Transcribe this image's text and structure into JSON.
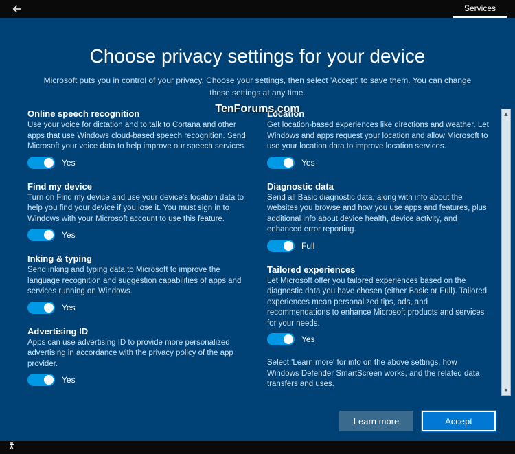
{
  "titlebar": {
    "tab_services": "Services"
  },
  "header": {
    "title": "Choose privacy settings for your device",
    "subtitle": "Microsoft puts you in control of your privacy. Choose your settings, then select 'Accept' to save them. You can change these settings at any time."
  },
  "watermark": "TenForums.com",
  "settings": {
    "speech": {
      "title": "Online speech recognition",
      "desc": "Use your voice for dictation and to talk to Cortana and other apps that use Windows cloud-based speech recognition. Send Microsoft your voice data to help improve our speech services.",
      "value": "Yes"
    },
    "findmydevice": {
      "title": "Find my device",
      "desc": "Turn on Find my device and use your device's location data to help you find your device if you lose it. You must sign in to Windows with your Microsoft account to use this feature.",
      "value": "Yes"
    },
    "inking": {
      "title": "Inking & typing",
      "desc": "Send inking and typing data to Microsoft to improve the language recognition and suggestion capabilities of apps and services running on Windows.",
      "value": "Yes"
    },
    "adid": {
      "title": "Advertising ID",
      "desc": "Apps can use advertising ID to provide more personalized advertising in accordance with the privacy policy of the app provider.",
      "value": "Yes"
    },
    "location": {
      "title": "Location",
      "desc": "Get location-based experiences like directions and weather. Let Windows and apps request your location and allow Microsoft to use your location data to improve location services.",
      "value": "Yes"
    },
    "diagnostic": {
      "title": "Diagnostic data",
      "desc": "Send all Basic diagnostic data, along with info about the websites you browse and how you use apps and features, plus additional info about device health, device activity, and enhanced error reporting.",
      "value": "Full"
    },
    "tailored": {
      "title": "Tailored experiences",
      "desc": "Let Microsoft offer you tailored experiences based on the diagnostic data you have chosen (either Basic or Full). Tailored experiences mean personalized tips, ads, and recommendations to enhance Microsoft products and services for your needs.",
      "value": "Yes"
    }
  },
  "footnote": "Select 'Learn more' for info on the above settings, how Windows Defender SmartScreen works, and the related data transfers and uses.",
  "footer": {
    "learn_more": "Learn more",
    "accept": "Accept"
  }
}
